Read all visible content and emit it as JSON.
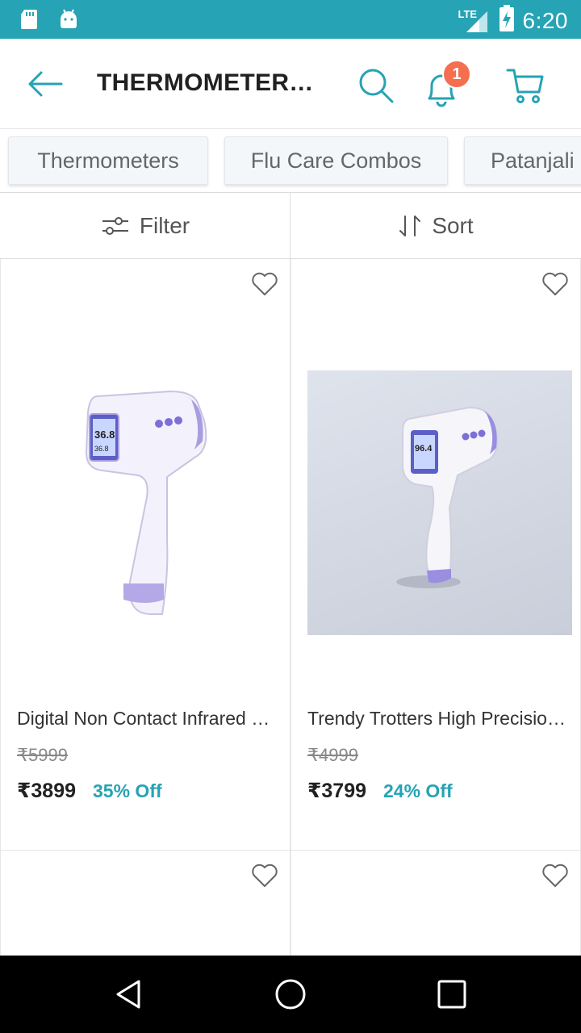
{
  "status_bar": {
    "time": "6:20",
    "network": "LTE",
    "icons": [
      "sd-card-icon",
      "android-icon",
      "signal-icon",
      "battery-charging-icon"
    ]
  },
  "header": {
    "title": "THERMOMETER…",
    "notification_count": "1",
    "icons": [
      "back-arrow-icon",
      "search-icon",
      "bell-icon",
      "cart-icon"
    ]
  },
  "categories": [
    {
      "label": "Thermometers"
    },
    {
      "label": "Flu Care Combos"
    },
    {
      "label": "Patanjali"
    }
  ],
  "toolbar": {
    "filter_label": "Filter",
    "sort_label": "Sort"
  },
  "products": [
    {
      "name": "Digital Non Contact Infrared …",
      "mrp": "₹5999",
      "price": "₹3899",
      "discount": "35% Off"
    },
    {
      "name": "Trendy Trotters High Precisio…",
      "mrp": "₹4999",
      "price": "₹3799",
      "discount": "24% Off"
    }
  ],
  "colors": {
    "accent": "#26a3b4",
    "badge": "#f36f4f",
    "status_bar": "#26a3b4"
  }
}
